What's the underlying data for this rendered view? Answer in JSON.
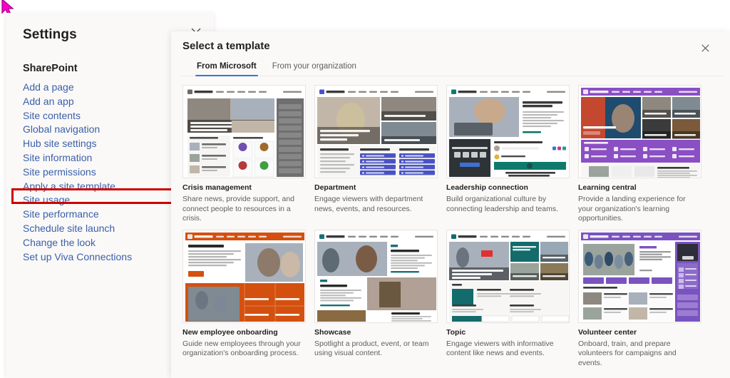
{
  "settings": {
    "title": "Settings",
    "close_label": "Close settings",
    "group_title": "SharePoint",
    "items": [
      {
        "label": "Add a page",
        "highlighted": false
      },
      {
        "label": "Add an app",
        "highlighted": false
      },
      {
        "label": "Site contents",
        "highlighted": false
      },
      {
        "label": "Global navigation",
        "highlighted": false
      },
      {
        "label": "Hub site settings",
        "highlighted": false
      },
      {
        "label": "Site information",
        "highlighted": false
      },
      {
        "label": "Site permissions",
        "highlighted": false
      },
      {
        "label": "Apply a site template",
        "highlighted": true
      },
      {
        "label": "Site usage",
        "highlighted": false
      },
      {
        "label": "Site performance",
        "highlighted": false
      },
      {
        "label": "Schedule site launch",
        "highlighted": false
      },
      {
        "label": "Change the look",
        "highlighted": false
      },
      {
        "label": "Set up Viva Connections",
        "highlighted": false
      }
    ],
    "highlight_color": "#cc0000"
  },
  "template_panel": {
    "title": "Select a template",
    "close_label": "Close template picker",
    "tabs": [
      {
        "label": "From Microsoft",
        "active": true
      },
      {
        "label": "From your organization",
        "active": false
      }
    ],
    "accent_color": "#2a7ad6",
    "cards": [
      {
        "title": "Crisis management",
        "description": "Share news, provide support, and connect people to resources in a crisis.",
        "theme": "#6b6b6b",
        "thumb_name": "crisis-management-thumbnail"
      },
      {
        "title": "Department",
        "description": "Engage viewers with department news, events, and resources.",
        "theme": "#4a53c4",
        "thumb_name": "department-thumbnail"
      },
      {
        "title": "Leadership connection",
        "description": "Build organizational culture by connecting leadership and teams.",
        "theme": "#0f7a6c",
        "thumb_name": "leadership-connection-thumbnail"
      },
      {
        "title": "Learning central",
        "description": "Provide a landing experience for your organization's learning opportunities.",
        "theme": "#8b4fc4",
        "thumb_name": "learning-central-thumbnail"
      },
      {
        "title": "New employee onboarding",
        "description": "Guide new employees through your organization's onboarding process.",
        "theme": "#d4500f",
        "thumb_name": "new-employee-onboarding-thumbnail"
      },
      {
        "title": "Showcase",
        "description": "Spotlight a product, event, or team using visual content.",
        "theme": "#1a6e78",
        "thumb_name": "showcase-thumbnail"
      },
      {
        "title": "Topic",
        "description": "Engage viewers with informative content like news and events.",
        "theme": "#136b6b",
        "thumb_name": "topic-thumbnail"
      },
      {
        "title": "Volunteer center",
        "description": "Onboard, train, and prepare volunteers for campaigns and events.",
        "theme": "#7a53c0",
        "thumb_name": "volunteer-center-thumbnail"
      }
    ]
  }
}
